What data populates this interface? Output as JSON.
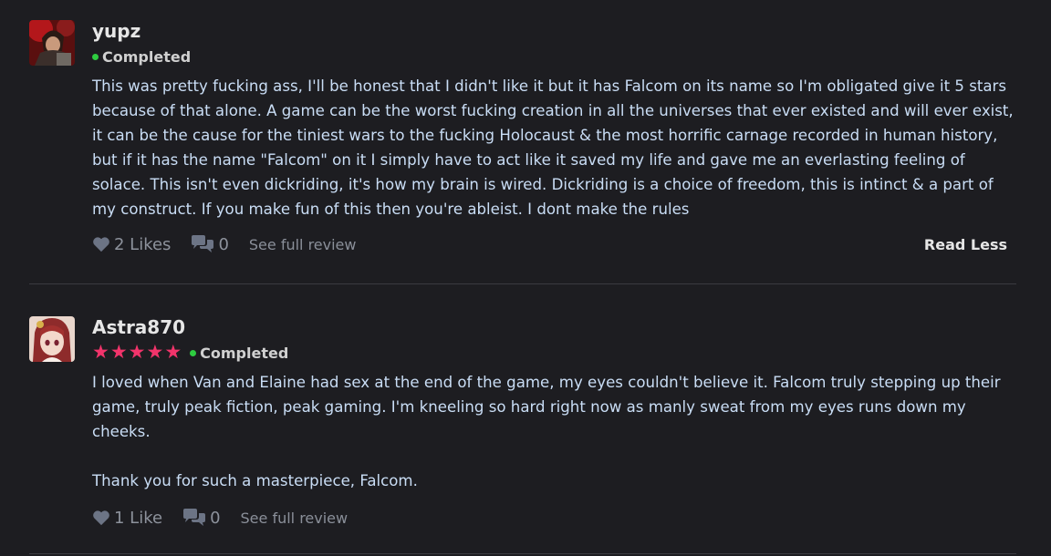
{
  "reviews": [
    {
      "username": "yupz",
      "status": "Completed",
      "rating_stars": 0,
      "text": "This was pretty fucking ass, I'll be honest that I didn't like it but it has Falcom on its name so I'm obligated give it 5 stars because of that alone. A game can be the worst fucking creation in all the universes that ever existed and will ever exist, it can be the cause for the tiniest wars to the fucking Holocaust & the most horrific carnage recorded in human history, but if it has the name \"Falcom\" on it I simply have to act like it saved my life and gave me an everlasting feeling of solace. This isn't even dickriding, it's how my brain is wired. Dickriding is a choice of freedom, this is intinct & a part of my construct. If you make fun of this then you're ableist. I dont make the rules",
      "likes": "2 Likes",
      "comments": "0",
      "see_full": "See full review",
      "read_less": "Read Less"
    },
    {
      "username": "Astra870",
      "status": "Completed",
      "rating_stars": 5,
      "text": "I loved when Van and Elaine had sex at the end of the game, my eyes couldn't believe it. Falcom truly stepping up their game, truly peak fiction, peak gaming. I'm kneeling so hard right now as manly sweat from my eyes runs down my cheeks.\n\nThank you for such a masterpiece, Falcom.",
      "likes": "1 Like",
      "comments": "0",
      "see_full": "See full review"
    }
  ],
  "colors": {
    "accent_star": "#f2346b",
    "status_dot": "#2ecc40",
    "background": "#1d1d21"
  }
}
